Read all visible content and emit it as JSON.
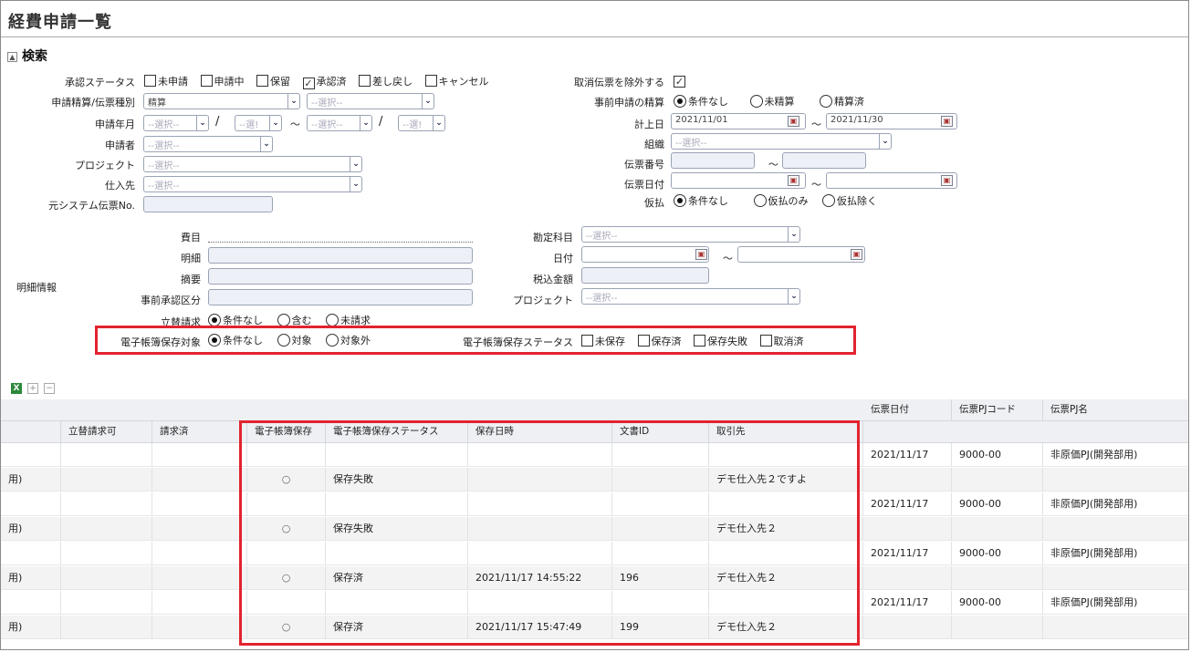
{
  "title": "経費申請一覧",
  "search": {
    "section_label": "検索",
    "toggle_glyph": "▲",
    "status_label": "承認ステータス",
    "status_options": [
      "未申請",
      "申請中",
      "保留",
      "承認済",
      "差し戻し",
      "キャンセル"
    ],
    "status_checked": [
      false,
      false,
      false,
      true,
      false,
      false
    ],
    "type_label": "申請精算/伝票種別",
    "type_value": "精算",
    "type2_placeholder": "--選択--",
    "ym_label": "申請年月",
    "ym_ph1": "--選択--",
    "ym_ph2": "--選!",
    "ym_ph3": "--選択--",
    "ym_ph4": "--選!",
    "slash": "/",
    "tilde": "～",
    "applicant_label": "申請者",
    "applicant_ph": "--選択--",
    "project_label": "プロジェクト",
    "project_ph": "--選択--",
    "vendor_label": "仕入先",
    "vendor_ph": "--選択--",
    "orig_label": "元システム伝票No.",
    "exclude_cancel_label": "取消伝票を除外する",
    "exclude_cancel_checked": true,
    "pre_settle_label": "事前申請の精算",
    "pre_settle_options": [
      "条件なし",
      "未精算",
      "精算済"
    ],
    "post_date_label": "計上日",
    "post_date_from": "2021/11/01",
    "post_date_to": "2021/11/30",
    "org_label": "組織",
    "org_ph": "--選択--",
    "slip_no_label": "伝票番号",
    "slip_date_label": "伝票日付",
    "temp_label": "仮払",
    "temp_options": [
      "条件なし",
      "仮払のみ",
      "仮払除く"
    ],
    "detail_label": "明細情報",
    "himoku_label": "費目",
    "meisai_label": "明細",
    "tekiyo_label": "摘要",
    "pre_approval_label": "事前承認区分",
    "tatekae_label": "立替請求",
    "tatekae_options": [
      "条件なし",
      "含む",
      "未請求"
    ],
    "kanjo_label": "勘定科目",
    "kanjo_ph": "--選択--",
    "hizuke_label": "日付",
    "zeikomi_label": "税込金額",
    "project2_label": "プロジェクト",
    "project2_ph": "--選択--",
    "ebook_target_label": "電子帳簿保存対象",
    "ebook_target_options": [
      "条件なし",
      "対象",
      "対象外"
    ],
    "ebook_status_label": "電子帳簿保存ステータス",
    "ebook_status_options": [
      "未保存",
      "保存済",
      "保存失敗",
      "取消済"
    ]
  },
  "toolbar": {
    "excel_glyph": "X",
    "expand_glyph": "+",
    "collapse_glyph": "−"
  },
  "grid": {
    "top_headers": [
      "伝票日付",
      "伝票PJコード",
      "伝票PJ名"
    ],
    "headers": [
      "立替請求可",
      "請求済",
      "電子帳簿保存",
      "電子帳簿保存ステータス",
      "保存日時",
      "文書ID",
      "取引先"
    ],
    "rows": [
      {
        "lead": "",
        "circle": "",
        "status": "",
        "saved": "",
        "docid": "",
        "vendor": "",
        "date": "2021/11/17",
        "pjcode": "9000-00",
        "pjname": "非原価PJ(開発部用)"
      },
      {
        "lead": "用)",
        "circle": "○",
        "status": "保存失敗",
        "saved": "",
        "docid": "",
        "vendor": "デモ仕入先２ですよ",
        "date": "",
        "pjcode": "",
        "pjname": ""
      },
      {
        "lead": "",
        "circle": "",
        "status": "",
        "saved": "",
        "docid": "",
        "vendor": "",
        "date": "2021/11/17",
        "pjcode": "9000-00",
        "pjname": "非原価PJ(開発部用)"
      },
      {
        "lead": "用)",
        "circle": "○",
        "status": "保存失敗",
        "saved": "",
        "docid": "",
        "vendor": "デモ仕入先２",
        "date": "",
        "pjcode": "",
        "pjname": ""
      },
      {
        "lead": "",
        "circle": "",
        "status": "",
        "saved": "",
        "docid": "",
        "vendor": "",
        "date": "2021/11/17",
        "pjcode": "9000-00",
        "pjname": "非原価PJ(開発部用)"
      },
      {
        "lead": "用)",
        "circle": "○",
        "status": "保存済",
        "saved": "2021/11/17 14:55:22",
        "docid": "196",
        "vendor": "デモ仕入先２",
        "date": "",
        "pjcode": "",
        "pjname": ""
      },
      {
        "lead": "",
        "circle": "",
        "status": "",
        "saved": "",
        "docid": "",
        "vendor": "",
        "date": "2021/11/17",
        "pjcode": "9000-00",
        "pjname": "非原価PJ(開発部用)"
      },
      {
        "lead": "用)",
        "circle": "○",
        "status": "保存済",
        "saved": "2021/11/17 15:47:49",
        "docid": "199",
        "vendor": "デモ仕入先２",
        "date": "",
        "pjcode": "",
        "pjname": ""
      }
    ]
  },
  "colors": {
    "highlight": "#e2232f",
    "header_bg": "#eef0f3"
  }
}
